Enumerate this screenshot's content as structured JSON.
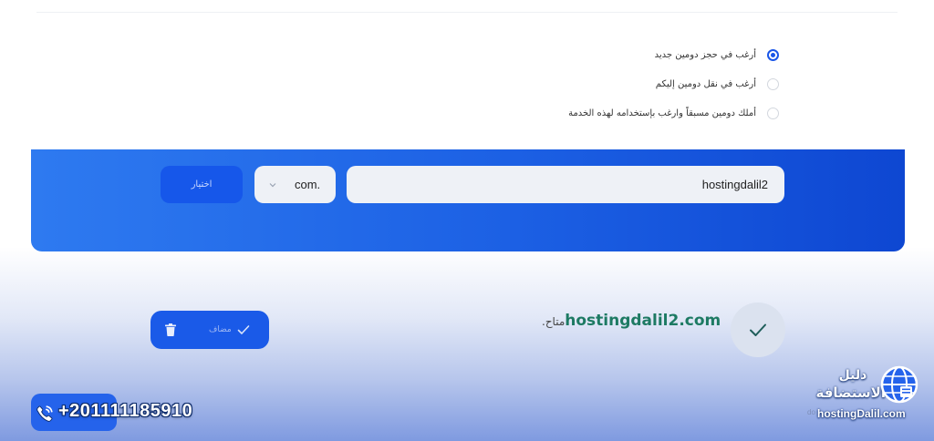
{
  "options": [
    {
      "label": "أرغب في حجز دومين جديد",
      "checked": true
    },
    {
      "label": "أرغب في نقل دومين إليكم",
      "checked": false
    },
    {
      "label": "أملك دومين مسبقاً وارغب بإستخدامه لهذه الخدمة",
      "checked": false
    }
  ],
  "search": {
    "domain_value": "hostingdalil2",
    "tld_value": "com.",
    "choose_label": "اختيار"
  },
  "result": {
    "domain": "hostingdalil2.com",
    "status": "متاح.",
    "added_label": "مضاف",
    "faint_text": "do"
  },
  "contact": {
    "phone": "+201111185910"
  },
  "watermark": {
    "line1": "دليل",
    "line2": "الاستضافة",
    "url": "hostingDalil.com"
  },
  "colors": {
    "accent": "#1a56e8",
    "panel_start": "#2e7af0",
    "panel_end": "#0e47d2",
    "available": "#1d7a63"
  },
  "icons": [
    "radio-icon",
    "chevron-down-icon",
    "trash-icon",
    "check-icon",
    "phone-icon",
    "globe-logo-icon"
  ]
}
